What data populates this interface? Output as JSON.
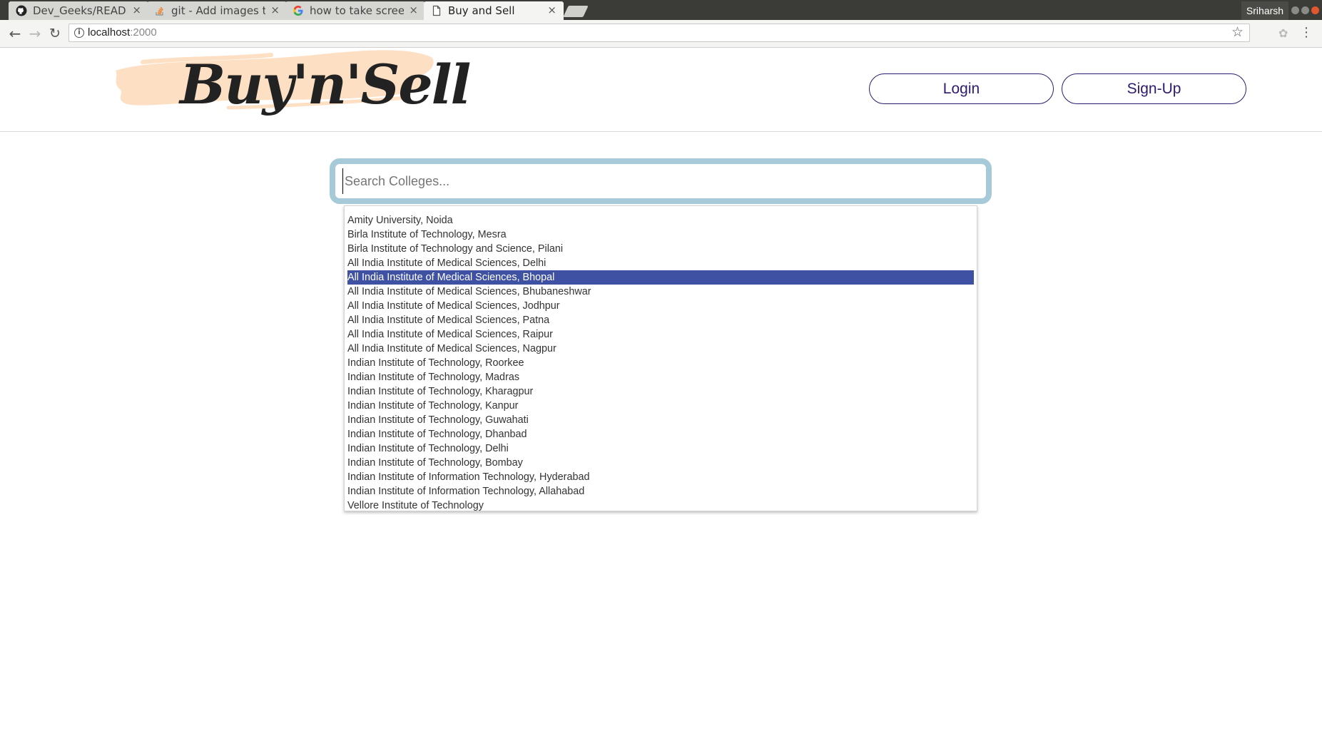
{
  "browser": {
    "tabs": [
      {
        "title": "Dev_Geeks/READM",
        "icon": "github-icon",
        "active": false
      },
      {
        "title": "git - Add images to R",
        "icon": "stackoverflow-icon",
        "active": false
      },
      {
        "title": "how to take screens",
        "icon": "google-icon",
        "active": false
      },
      {
        "title": "Buy and Sell",
        "icon": "page-icon",
        "active": true
      }
    ],
    "close_glyph": "×",
    "profile_name": "Sriharsh",
    "url_host": "localhost",
    "url_port": ":2000"
  },
  "header": {
    "logo_text": "Buy'n'Sell",
    "login_label": "Login",
    "signup_label": "Sign-Up"
  },
  "search": {
    "placeholder": "Search Colleges...",
    "value": ""
  },
  "results": {
    "selected_index": 4,
    "items": [
      "Amity University, Noida",
      "Birla Institute of Technology, Mesra",
      "Birla Institute of Technology and Science, Pilani",
      "All India Institute of Medical Sciences, Delhi",
      "All India Institute of Medical Sciences, Bhopal",
      "All India Institute of Medical Sciences, Bhubaneshwar",
      "All India Institute of Medical Sciences, Jodhpur",
      "All India Institute of Medical Sciences, Patna",
      "All India Institute of Medical Sciences, Raipur",
      "All India Institute of Medical Sciences, Nagpur",
      "Indian Institute of Technology, Roorkee",
      "Indian Institute of Technology, Madras",
      "Indian Institute of Technology, Kharagpur",
      "Indian Institute of Technology, Kanpur",
      "Indian Institute of Technology, Guwahati",
      "Indian Institute of Technology, Dhanbad",
      "Indian Institute of Technology, Delhi",
      "Indian Institute of Technology, Bombay",
      "Indian Institute of Information Technology, Hyderabad",
      "Indian Institute of Information Technology, Allahabad",
      "Vellore Institute of Technology"
    ]
  },
  "colors": {
    "accent": "#2e1a6e",
    "search_border": "#a7cad8",
    "selection": "#3f51a3",
    "logo_brush": "#fde0c4"
  }
}
